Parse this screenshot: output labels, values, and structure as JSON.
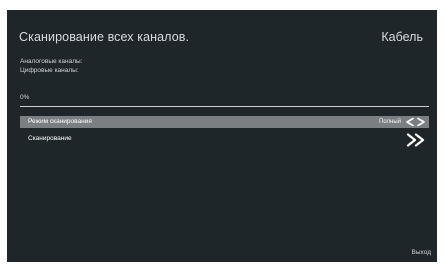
{
  "header": {
    "title": "Сканирование всех каналов.",
    "source": "Кабель"
  },
  "counts": {
    "analog_label": "Аналоговые каналы:",
    "digital_label": "Цифровые каналы:"
  },
  "progress": {
    "label": "0%",
    "fraction": 0
  },
  "menu": {
    "items": [
      {
        "label": "Режим сканирования",
        "value": "Полный"
      },
      {
        "label": "Сканирование"
      }
    ]
  },
  "footer": {
    "exit_label": "Выход"
  },
  "colors": {
    "background": "#1f2629",
    "highlight": "#7c7f81",
    "text": "#e6e8e9"
  },
  "icons": {
    "prev": "chevron-left-icon",
    "next": "chevron-right-icon",
    "start": "double-chevron-right-icon"
  }
}
